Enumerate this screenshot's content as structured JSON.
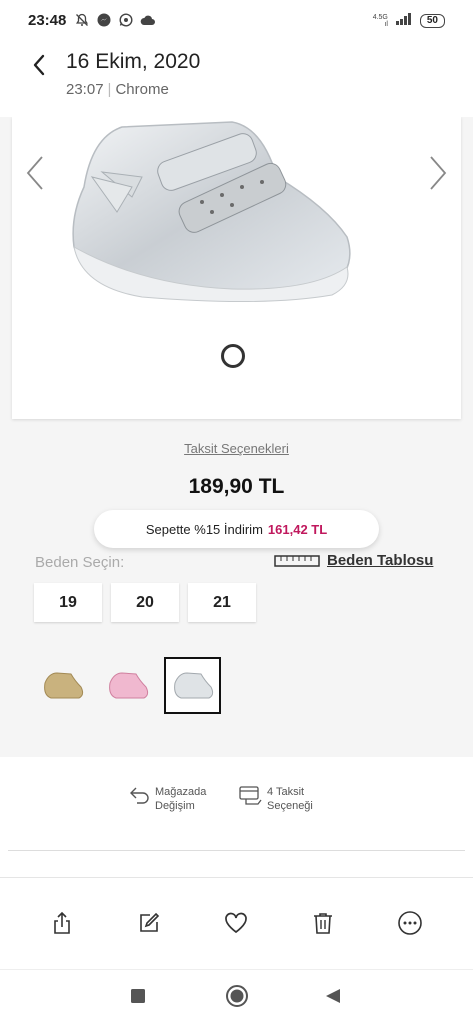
{
  "status_bar": {
    "time": "23:48",
    "network_top": "4.5G",
    "network_bottom": "ıl",
    "battery": "50"
  },
  "history": {
    "date": "16 Ekim, 2020",
    "time": "23:07",
    "app": "Chrome"
  },
  "product": {
    "installment_link": "Taksit Seçenekleri",
    "price": "189,90 TL",
    "discount_text": "Sepette %15 İndirim",
    "discount_price": "161,42 TL",
    "size_label": "Beden Seçin:",
    "size_table_link": "Beden Tablosu",
    "sizes": [
      "19",
      "20",
      "21"
    ],
    "swatches": [
      "gold",
      "pink",
      "silver"
    ],
    "selected_swatch": "silver"
  },
  "features": {
    "exchange": [
      "Mağazada",
      "Değişim"
    ],
    "installment": [
      "4 Taksit",
      "Seçeneği"
    ]
  },
  "colors": {
    "discount_accent": "#c0185d",
    "page_bg": "#f5f5f5"
  },
  "icons": {
    "toolbar": [
      "share-icon",
      "edit-icon",
      "heart-icon",
      "trash-icon",
      "more-icon"
    ],
    "nav": [
      "recent-apps-icon",
      "home-icon",
      "back-icon"
    ]
  }
}
